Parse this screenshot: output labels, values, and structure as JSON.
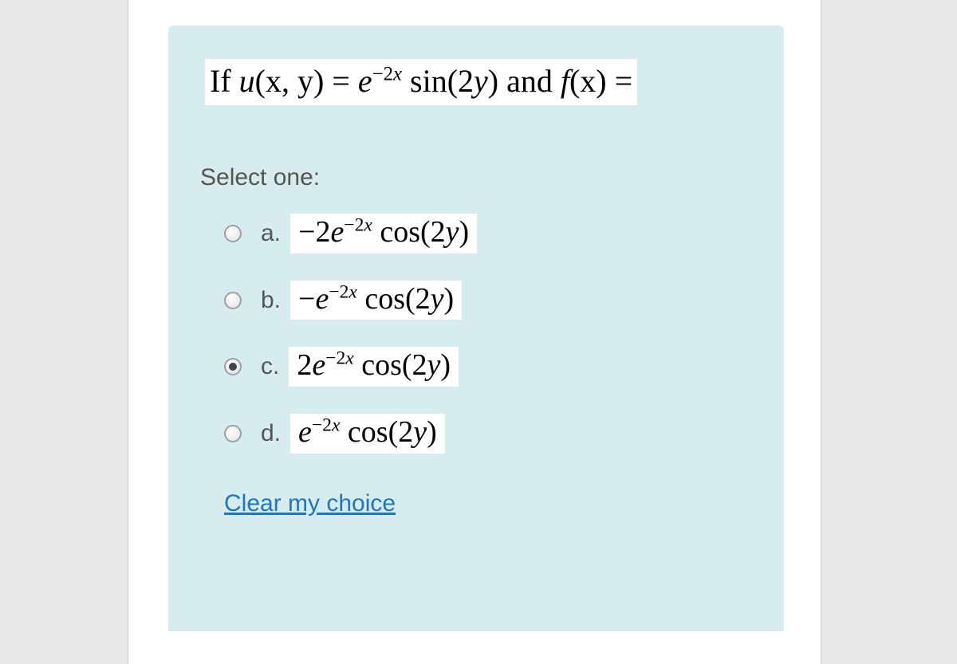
{
  "question": {
    "prefix": "If ",
    "u_fn": "u",
    "u_args": "(x, y) = ",
    "e_base": "e",
    "u_exp_text": "−2x",
    "sin_text": " sin(2",
    "y_var": "y",
    "after_sin": ") and ",
    "f_fn": "f",
    "f_args": "(x) ="
  },
  "select_label": "Select one:",
  "options": [
    {
      "letter": "a.",
      "value": "a",
      "checked": false,
      "coef": "−2",
      "e": "e",
      "exp": "−2x",
      "cos_pre": " cos(2",
      "yv": "y",
      "close": ")"
    },
    {
      "letter": "b.",
      "value": "b",
      "checked": false,
      "coef": "−",
      "e": "e",
      "exp": "−2x",
      "cos_pre": " cos(2",
      "yv": "y",
      "close": ")"
    },
    {
      "letter": "c.",
      "value": "c",
      "checked": true,
      "coef": "2",
      "e": "e",
      "exp": "−2x",
      "cos_pre": " cos(2",
      "yv": "y",
      "close": ")"
    },
    {
      "letter": "d.",
      "value": "d",
      "checked": false,
      "coef": "",
      "e": "e",
      "exp": "−2x",
      "cos_pre": " cos(2",
      "yv": "y",
      "close": ")"
    }
  ],
  "clear_label": "Clear my choice"
}
